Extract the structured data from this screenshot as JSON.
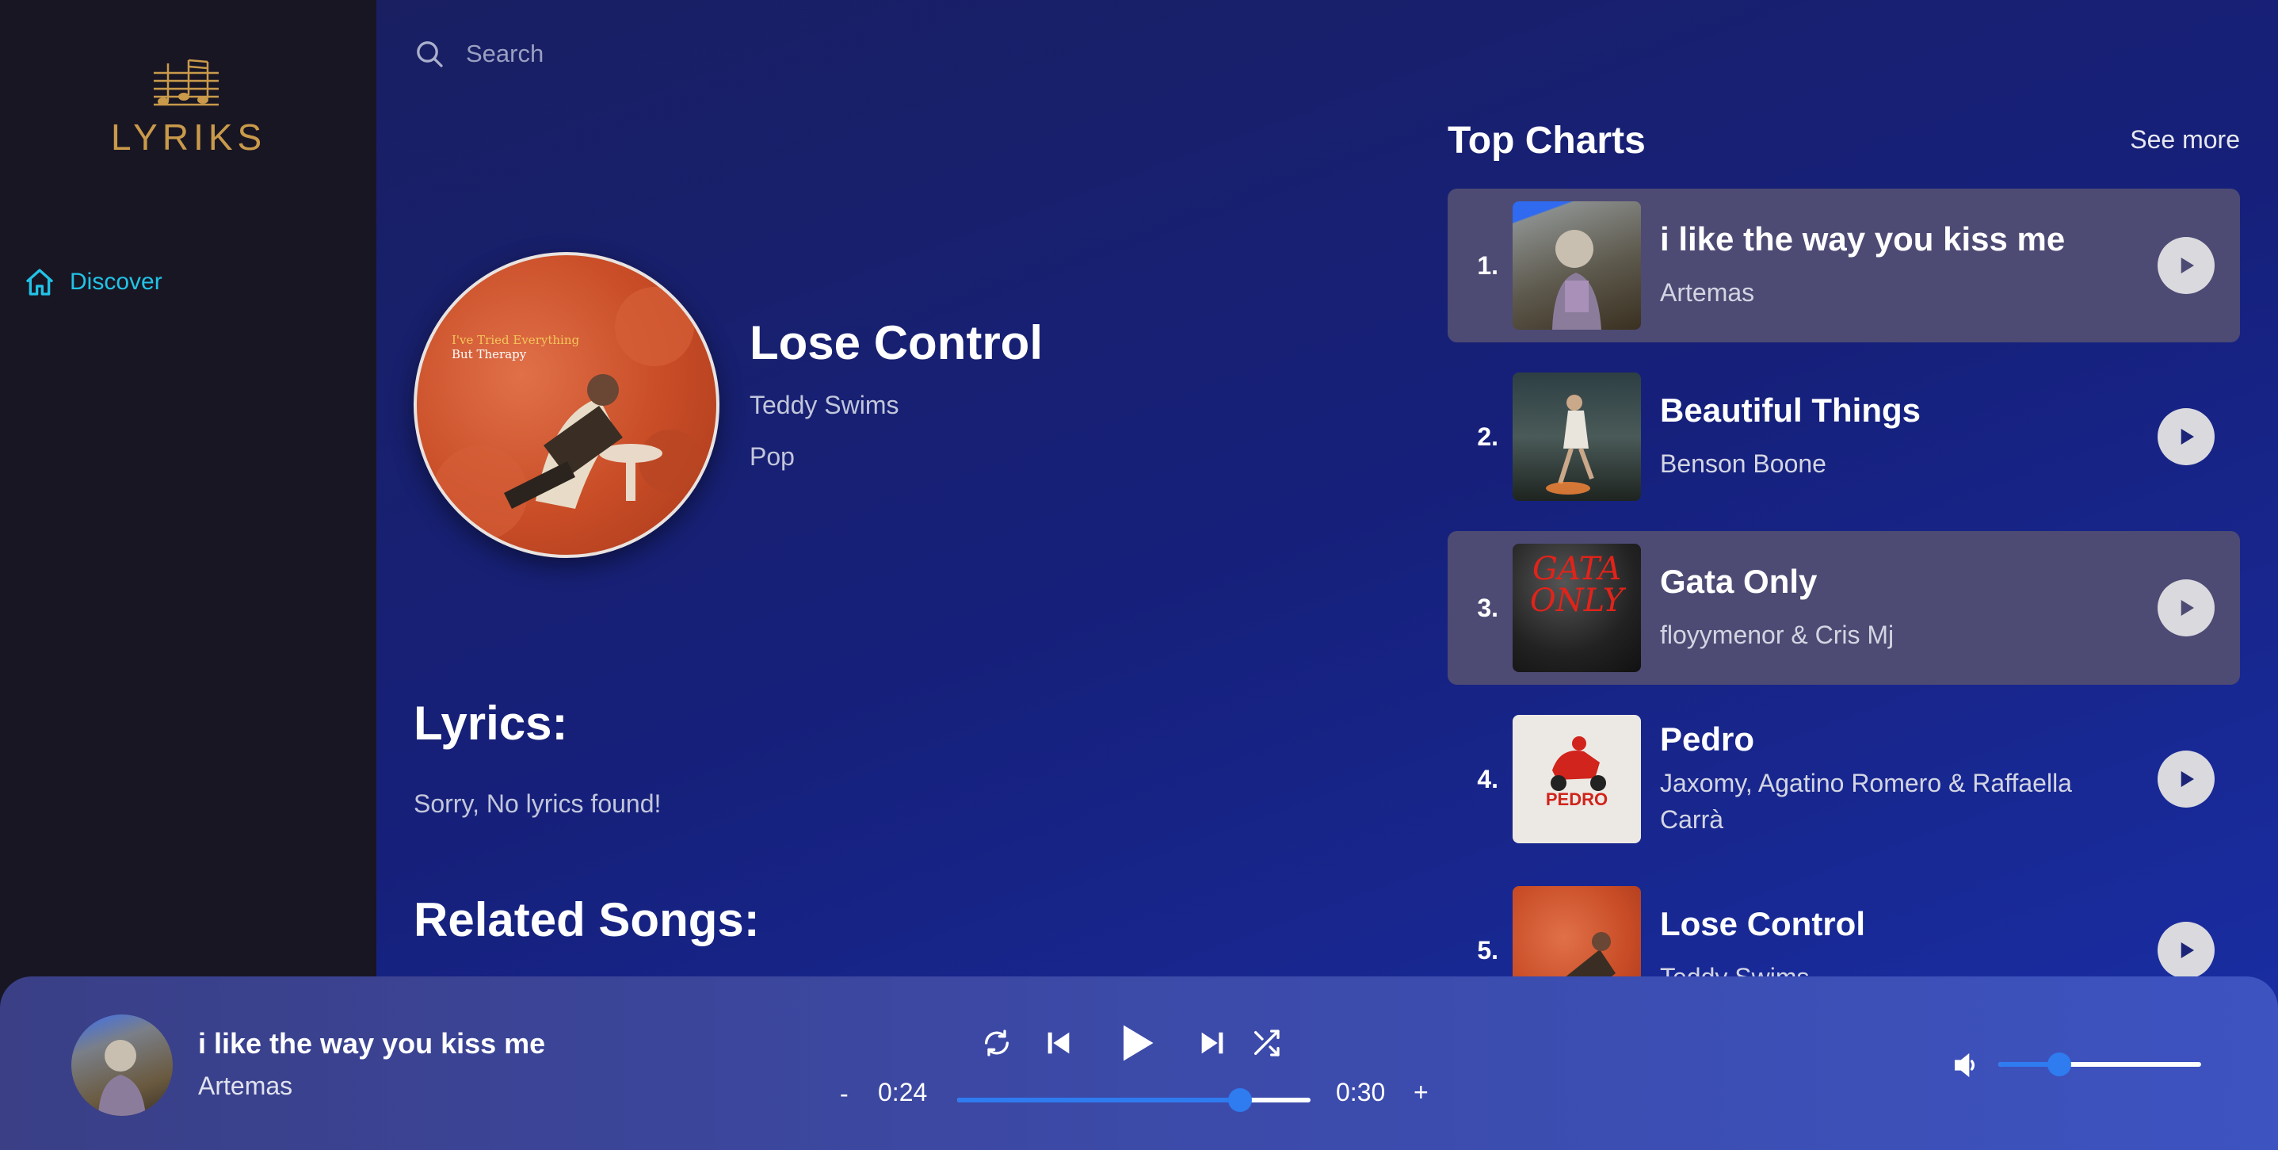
{
  "app": {
    "logo_text": "LYRIKS"
  },
  "sidebar": {
    "items": [
      {
        "label": "Discover",
        "icon": "home-icon",
        "active": true
      }
    ]
  },
  "search": {
    "placeholder": "Search",
    "value": ""
  },
  "song": {
    "title": "Lose Control",
    "artist": "Teddy Swims",
    "genre": "Pop",
    "cover_text_line1": "I've Tried Everything",
    "cover_text_line2": "But Therapy"
  },
  "lyrics": {
    "heading": "Lyrics:",
    "text": "Sorry, No lyrics found!"
  },
  "related": {
    "heading": "Related Songs:"
  },
  "top_charts": {
    "title": "Top Charts",
    "see_more": "See more",
    "items": [
      {
        "rank": "1.",
        "title": "i like the way you kiss me",
        "artist": "Artemas",
        "active": true
      },
      {
        "rank": "2.",
        "title": "Beautiful Things",
        "artist": "Benson Boone",
        "active": false
      },
      {
        "rank": "3.",
        "title": "Gata Only",
        "artist": "floyymenor & Cris Mj",
        "active": true
      },
      {
        "rank": "4.",
        "title": "Pedro",
        "artist": "Jaxomy, Agatino Romero & Raffaella Carrà",
        "active": false
      },
      {
        "rank": "5.",
        "title": "Lose Control",
        "artist": "Teddy Swims",
        "active": false
      }
    ],
    "thumb_texts": {
      "gata": "GATA ONLY",
      "pedro": "PEDRO"
    }
  },
  "player": {
    "title": "i like the way you kiss me",
    "artist": "Artemas",
    "time_current": "0:24",
    "time_total": "0:30",
    "seek_minus": "-",
    "seek_plus": "+",
    "progress": 0.8,
    "volume": 0.3,
    "is_playing": false
  },
  "colors": {
    "accent": "#2f7bf0",
    "nav_active": "#22c3e6",
    "logo": "#c99a4a",
    "active_row": "#4d4a74"
  }
}
